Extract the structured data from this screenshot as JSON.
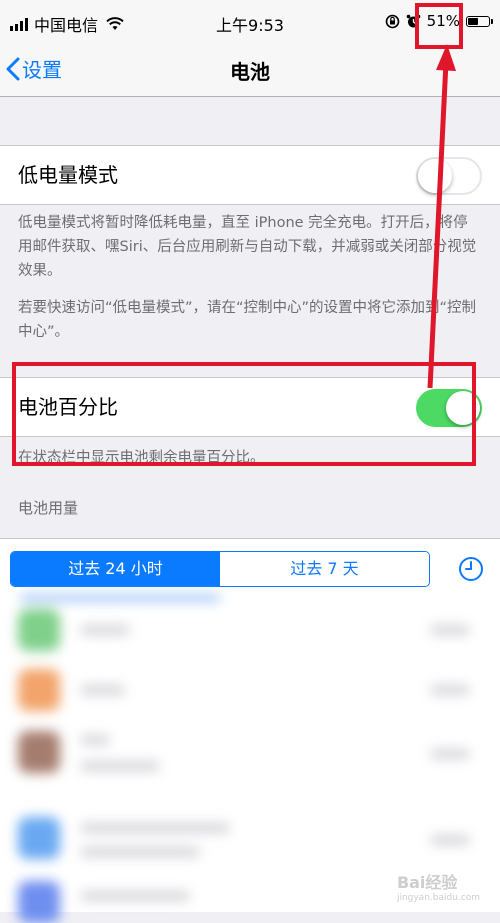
{
  "status_bar": {
    "carrier": "中国电信",
    "time": "上午9:53",
    "battery_percent": "51%",
    "battery_level": 0.51,
    "icons": [
      "signal-icon",
      "wifi-icon",
      "rotation-lock-icon",
      "alarm-icon",
      "battery-icon"
    ]
  },
  "nav": {
    "back_label": "设置",
    "title": "电池"
  },
  "low_power": {
    "label": "低电量模式",
    "enabled": false,
    "footer_1": "低电量模式将暂时降低耗电量，直至 iPhone 完全充电。打开后，将停用邮件获取、嘿Siri、后台应用刷新与自动下载，并减弱或关闭部分视觉效果。",
    "footer_2": "若要快速访问“低电量模式”，请在“控制中心”的设置中将它添加到“控制中心”。"
  },
  "battery_percentage": {
    "label": "电池百分比",
    "enabled": true,
    "footer": "在状态栏中显示电池剩余电量百分比。"
  },
  "usage": {
    "header": "电池用量",
    "segments": [
      "过去 24 小时",
      "过去 7 天"
    ],
    "selected_segment": 0
  },
  "watermark": {
    "brand": "Bai经验",
    "url": "jingyan.baidu.com"
  },
  "colors": {
    "accent": "#0a7aff",
    "toggle_on": "#4cd964",
    "annotation_red": "#e0162b"
  }
}
